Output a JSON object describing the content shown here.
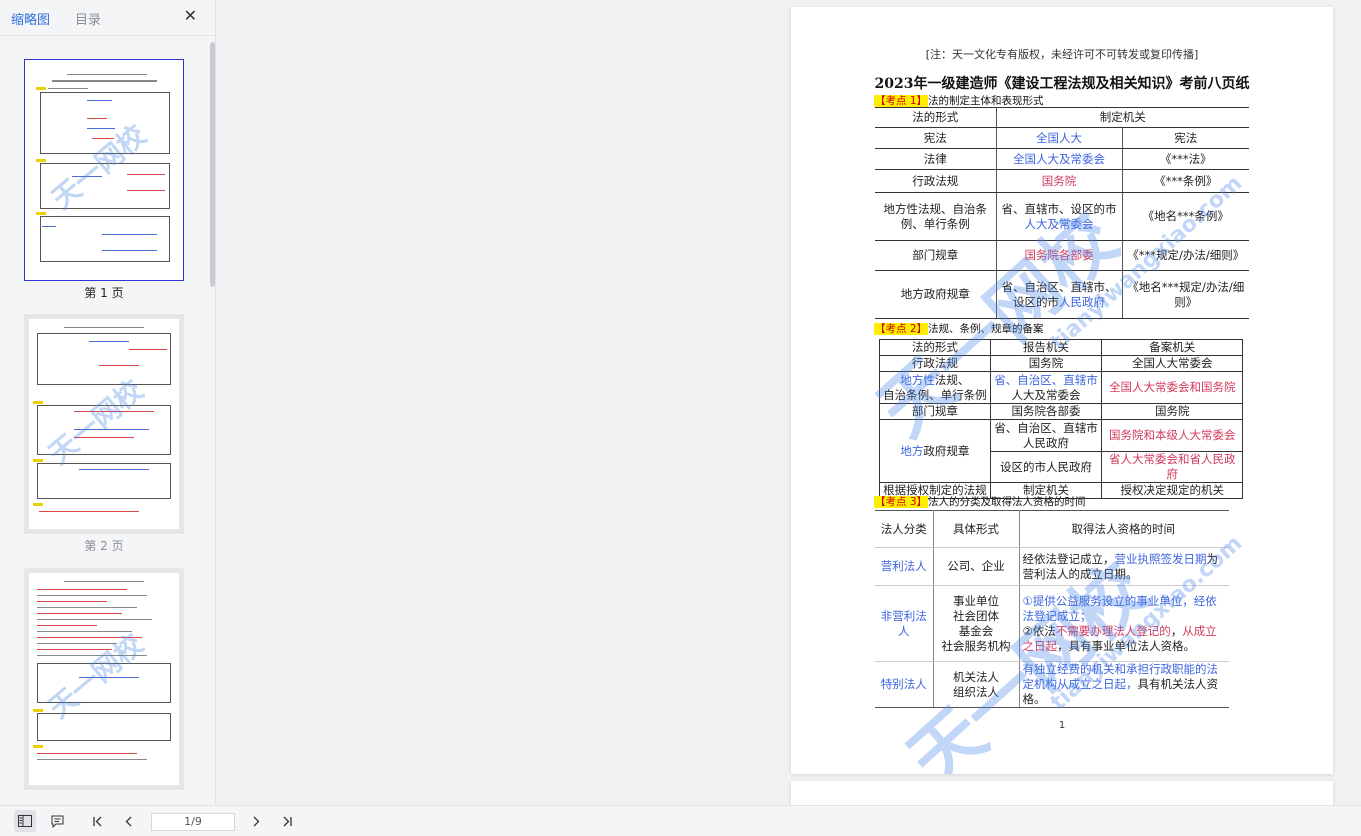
{
  "sidebar": {
    "tab_thumbnail": "缩略图",
    "tab_toc": "目录",
    "close": "✕",
    "thumbnails": [
      {
        "label": "第 1 页"
      },
      {
        "label": "第 2 页"
      },
      {
        "label": ""
      }
    ]
  },
  "document": {
    "notice": "[注：天一文化专有版权，未经许可不可转发或复印传播]",
    "title": "2023年一级建造师《建设工程法规及相关知识》考前八页纸",
    "watermark_text": "天一网校",
    "watermark_url": "tianyiwangxiao.com",
    "section1": {
      "tag": "【考点 1】",
      "title": "法的制定主体和表现形式",
      "headers": [
        "法的形式",
        "制定机关"
      ],
      "rows": [
        {
          "form": "宪法",
          "organ": "全国人大",
          "name": "宪法"
        },
        {
          "form": "法律",
          "organ": "全国人大及常委会",
          "name": "《***法》"
        },
        {
          "form": "行政法规",
          "organ": "国务院",
          "name": "《***条例》"
        },
        {
          "form": "地方性法规、自治条例、单行条例",
          "organ_prefix": "省、直辖市、设区的市",
          "organ": "人大及常委会",
          "name": "《地名***条例》"
        },
        {
          "form": "部门规章",
          "organ": "国务院各部委",
          "name": "《***规定/办法/细则》"
        },
        {
          "form": "地方政府规章",
          "organ_prefix": "省、自治区、直辖市、设区的市",
          "organ": "人民政府",
          "name": "《地名***规定/办法/细则》"
        }
      ]
    },
    "section2": {
      "tag": "【考点 2】",
      "title": "法规、条例、规章的备案",
      "headers": [
        "法的形式",
        "报告机关",
        "备案机关"
      ],
      "r1": [
        "行政法规",
        "国务院",
        "全国人大常委会"
      ],
      "r2_form_a": "地方性",
      "r2_form_b": "法规、",
      "r2_form_c": "自治条例、单行条例",
      "r2_rep_a": "省、自治区、直辖市",
      "r2_rep_b": "人大及常委会",
      "r2_rec": "全国人大常委会和国务院",
      "r3": [
        "部门规章",
        "国务院各部委",
        "国务院"
      ],
      "r4_form_a": "地方",
      "r4_form_b": "政府规章",
      "r4_rep_a": "省、自治区、直辖市人民政府",
      "r4_rec_a": "国务院和本级人大常委会",
      "r4_rep_b": "设区的市人民政府",
      "r4_rec_b": "省人大常委会和省人民政府",
      "r5": [
        "根据授权制定的法规",
        "制定机关",
        "授权决定规定的机关"
      ]
    },
    "section3": {
      "tag": "【考点 3】",
      "title": "法人的分类及取得法人资格的时间",
      "headers": [
        "法人分类",
        "具体形式",
        "取得法人资格的时间"
      ],
      "r1": {
        "cat": "营利法人",
        "forms": "公司、企业",
        "time_a": "经依法登记成立，",
        "time_b": "营业执照签发日期",
        "time_c": "为营利法人的成立日期。"
      },
      "r2": {
        "cat": "非营利法人",
        "forms": [
          "事业单位",
          "社会团体",
          "基金会",
          "社会服务机构"
        ],
        "time_a": "①提供公益服务设立的事业单位，经依法登记成立；",
        "time_b": "②依法",
        "time_c": "不需要办理法人登记的",
        "time_d": "，",
        "time_e": "从成立之日起",
        "time_f": "，具有事业单位法人资格。"
      },
      "r3": {
        "cat": "特别法人",
        "forms": [
          "机关法人",
          "组织法人"
        ],
        "time_a": "有独立经费的机关和承担行政职能的法定机构从成立之日起，",
        "time_b": "具有机关法人资格。"
      }
    },
    "page_number": "1"
  },
  "toolbar": {
    "page_indicator": "1/9"
  }
}
